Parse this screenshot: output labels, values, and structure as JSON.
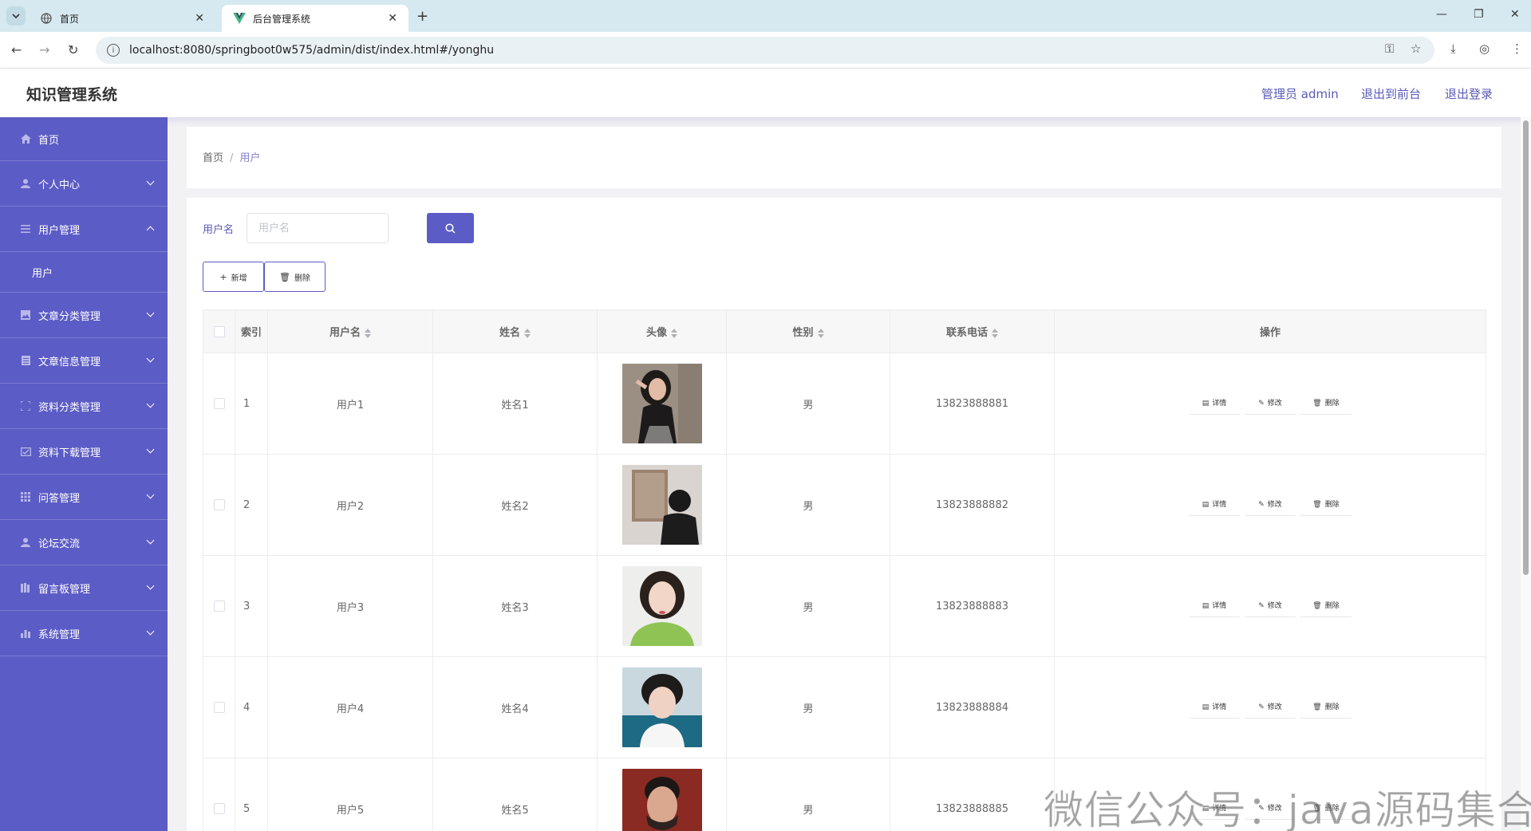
{
  "browser": {
    "tabs": [
      {
        "title": "首页"
      },
      {
        "title": "后台管理系统"
      }
    ],
    "url": "localhost:8080/springboot0w575/admin/dist/index.html#/yonghu"
  },
  "header": {
    "title": "知识管理系统",
    "admin_label": "管理员 admin",
    "to_front": "退出到前台",
    "logout": "退出登录"
  },
  "sidebar": {
    "items": [
      {
        "label": "首页",
        "icon": "home-icon"
      },
      {
        "label": "个人中心",
        "icon": "person-icon"
      },
      {
        "label": "用户管理",
        "icon": "menu-icon"
      },
      {
        "label": "用户",
        "icon": ""
      },
      {
        "label": "文章分类管理",
        "icon": "image-icon"
      },
      {
        "label": "文章信息管理",
        "icon": "document-icon"
      },
      {
        "label": "资料分类管理",
        "icon": "frame-icon"
      },
      {
        "label": "资料下载管理",
        "icon": "card-icon"
      },
      {
        "label": "问答管理",
        "icon": "grid-icon"
      },
      {
        "label": "论坛交流",
        "icon": "person-icon"
      },
      {
        "label": "留言板管理",
        "icon": "books-icon"
      },
      {
        "label": "系统管理",
        "icon": "bar-chart-icon"
      }
    ]
  },
  "breadcrumb": {
    "home": "首页",
    "sep": "/",
    "current": "用户"
  },
  "search": {
    "label": "用户名",
    "placeholder": "用户名",
    "value": ""
  },
  "toolbar": {
    "add": "新增",
    "delete": "删除"
  },
  "table": {
    "columns": [
      "索引",
      "用户名",
      "姓名",
      "头像",
      "性别",
      "联系电话",
      "操作"
    ],
    "rows": [
      {
        "index": "1",
        "username": "用户1",
        "name": "姓名1",
        "gender": "男",
        "phone": "13823888881"
      },
      {
        "index": "2",
        "username": "用户2",
        "name": "姓名2",
        "gender": "男",
        "phone": "13823888882"
      },
      {
        "index": "3",
        "username": "用户3",
        "name": "姓名3",
        "gender": "男",
        "phone": "13823888883"
      },
      {
        "index": "4",
        "username": "用户4",
        "name": "姓名4",
        "gender": "男",
        "phone": "13823888884"
      },
      {
        "index": "5",
        "username": "用户5",
        "name": "姓名5",
        "gender": "男",
        "phone": "13823888885"
      }
    ],
    "actions": {
      "detail": "详情",
      "edit": "修改",
      "delete": "删除"
    }
  },
  "watermark": "微信公众号：java源码集合",
  "colors": {
    "accent": "#5c5cc6",
    "link": "#5a5ab8"
  }
}
